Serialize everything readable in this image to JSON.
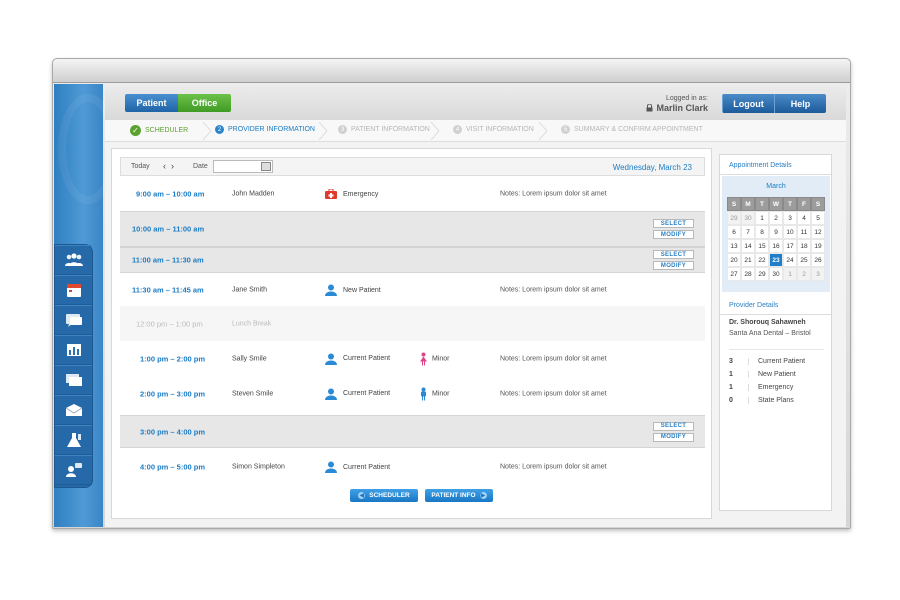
{
  "header": {
    "toggle": {
      "patient": "Patient",
      "office": "Office"
    },
    "login_label": "Logged in as:",
    "user_name": "Marlin Clark",
    "logout": "Logout",
    "help": "Help"
  },
  "wizard": {
    "steps": [
      {
        "num": "✓",
        "label": "Scheduler",
        "state": "done"
      },
      {
        "num": "2",
        "label": "Provider Information",
        "state": "active"
      },
      {
        "num": "3",
        "label": "Patient Information",
        "state": "pending"
      },
      {
        "num": "4",
        "label": "Visit Information",
        "state": "pending"
      },
      {
        "num": "5",
        "label": "Summary & Confirm Appointment",
        "state": "pending"
      }
    ]
  },
  "toolbar": {
    "today": "Today",
    "prev": "‹",
    "next": "›",
    "date_label": "Date",
    "date_value": "",
    "current_date": "Wednesday, March 23"
  },
  "schedule": [
    {
      "time": "9:00 am  –  10:00 am",
      "name": "John Madden",
      "type": "Emergency",
      "type_icon": "first-aid-kit-icon",
      "notes": "Notes: Lorem ipsum dolor sit amet"
    },
    {
      "time": "10:00 am  –  11:00 am",
      "select": "SELECT",
      "modify": "MODIFY"
    },
    {
      "time": "11:00 am  –  11:30 am",
      "select": "SELECT",
      "modify": "MODIFY"
    },
    {
      "time": "11:30 am  –  11:45 am",
      "name": "Jane Smith",
      "type": "New Patient",
      "type_icon": "person-icon",
      "notes": "Notes: Lorem ipsum dolor sit amet"
    },
    {
      "time": "12:00 pm  –  1:00 pm",
      "name": "Lunch Break"
    },
    {
      "time": "1:00 pm  –  2:00 pm",
      "name": "Sally Smile",
      "type": "Current Patient",
      "type_icon": "person-icon",
      "minor": "Minor",
      "minor_icon": "girl-icon",
      "notes": "Notes: Lorem ipsum dolor sit amet"
    },
    {
      "time": "2:00 pm  –  3:00 pm",
      "name": "Steven Smile",
      "type": "Current Patient",
      "type_icon": "person-icon",
      "minor": "Minor",
      "minor_icon": "boy-icon",
      "notes": "Notes: Lorem ipsum dolor sit amet"
    },
    {
      "time": "3:00 pm  –  4:00 pm",
      "select": "SELECT",
      "modify": "MODIFY"
    },
    {
      "time": "4:00 pm  –  5:00 pm",
      "name": "Simon Simpleton",
      "type": "Current Patient",
      "type_icon": "person-icon",
      "notes": "Notes: Lorem ipsum dolor sit amet"
    }
  ],
  "bottom_buttons": {
    "scheduler": "SCHEDULER",
    "patient_info": "PATIENT INFO"
  },
  "sidebar": {
    "appointment_title": "Appointment Details",
    "month": "March",
    "weekdays": [
      "S",
      "M",
      "T",
      "W",
      "T",
      "F",
      "S"
    ],
    "days": [
      "29",
      "30",
      "1",
      "2",
      "3",
      "4",
      "5",
      "6",
      "7",
      "8",
      "9",
      "10",
      "11",
      "12",
      "13",
      "14",
      "15",
      "16",
      "17",
      "18",
      "19",
      "20",
      "21",
      "22",
      "23",
      "24",
      "25",
      "26",
      "27",
      "28",
      "29",
      "30",
      "1",
      "2",
      "3"
    ],
    "selected_day": "23",
    "provider_title": "Provider Details",
    "doctor": "Dr. Shorouq Sahawneh",
    "office": "Santa Ana Dental – Bristol",
    "stats": [
      {
        "count": "3",
        "label": "Current Patient"
      },
      {
        "count": "1",
        "label": "New Patient"
      },
      {
        "count": "1",
        "label": "Emergency"
      },
      {
        "count": "0",
        "label": "State Plans"
      }
    ]
  },
  "colors": {
    "accent": "#1b7cc5",
    "office_green": "#4fa82c",
    "sidebar_blue": "#3a86c6"
  }
}
